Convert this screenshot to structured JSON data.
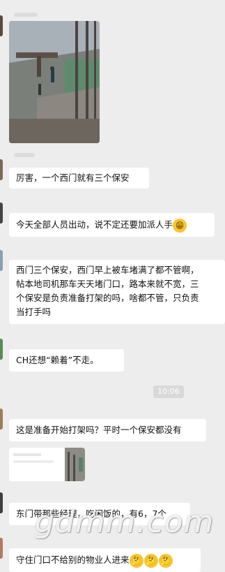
{
  "messages": {
    "m1": "厉害，一个西门就有三个保安",
    "m2": "今天全部人员出动，说不定还要加派人手",
    "m3_lines": [
      "西门三个保安，西门早上被车堵满了都不管啊，",
      "帖本地司机那车天天堵门口，路本来就不宽，三",
      "个保安是负责准备打架的吗，啥都不管，只负责",
      "当打手吗"
    ],
    "m4": "CH还想“赖着”不走。",
    "m5": "这是准备开始打架吗？平时一个保安都没有",
    "m6": "东门带那些经理，吃闲饭的，有6，7个",
    "m7": "守住门口不给别的物业人进来"
  },
  "timestamp": "10:06",
  "watermark": "gdmm.com",
  "icons": {
    "grin_emoji": "grinning-face-emoji",
    "thinking_emoji": "thinking-face-emoji"
  },
  "colors": {
    "background": "#ededed",
    "bubble": "#ffffff",
    "emoji": "#f7c531"
  }
}
